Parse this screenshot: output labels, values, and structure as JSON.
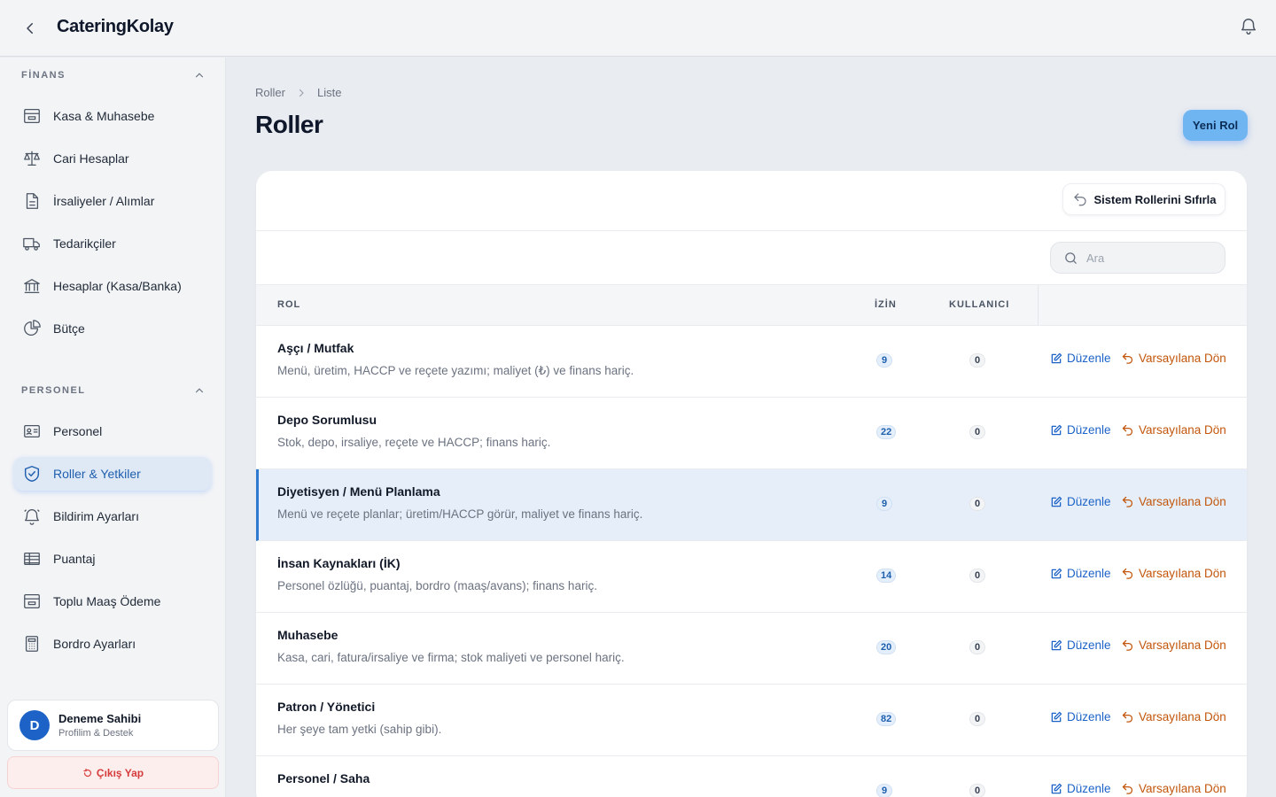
{
  "app": {
    "title": "CateringKolay"
  },
  "sidebar": {
    "sections": [
      {
        "label": "FİNANS",
        "items": [
          {
            "label": "Kasa & Muhasebe",
            "icon": "inbox-tray-icon"
          },
          {
            "label": "Cari Hesaplar",
            "icon": "scale-icon"
          },
          {
            "label": "İrsaliyeler / Alımlar",
            "icon": "document-icon"
          },
          {
            "label": "Tedarikçiler",
            "icon": "truck-icon"
          },
          {
            "label": "Hesaplar (Kasa/Banka)",
            "icon": "bank-icon"
          },
          {
            "label": "Bütçe",
            "icon": "pie-chart-icon"
          }
        ]
      },
      {
        "label": "PERSONEL",
        "items": [
          {
            "label": "Personel",
            "icon": "id-card-icon"
          },
          {
            "label": "Roller & Yetkiler",
            "icon": "shield-check-icon",
            "active": true
          },
          {
            "label": "Bildirim Ayarları",
            "icon": "bell-icon"
          },
          {
            "label": "Puantaj",
            "icon": "table-icon"
          },
          {
            "label": "Toplu Maaş Ödeme",
            "icon": "inbox-tray-icon"
          },
          {
            "label": "Bordro Ayarları",
            "icon": "calculator-icon"
          }
        ]
      }
    ],
    "user": {
      "initial": "D",
      "name": "Deneme Sahibi",
      "subtitle": "Profilim & Destek"
    },
    "logout_label": "Çıkış Yap"
  },
  "breadcrumb": {
    "parent": "Roller",
    "current": "Liste"
  },
  "page": {
    "title": "Roller",
    "new_button": "Yeni Rol"
  },
  "toolbar": {
    "reset_label": "Sistem Rollerini Sıfırla",
    "search_placeholder": "Ara"
  },
  "table": {
    "columns": {
      "role": "ROL",
      "permissions": "İZİN",
      "users": "KULLANICI"
    },
    "edit_label": "Düzenle",
    "reset_label": "Varsayılana Dön",
    "rows": [
      {
        "name": "Aşçı / Mutfak",
        "description": "Menü, üretim, HACCP ve reçete yazımı; maliyet (₺) ve finans hariç.",
        "permissions": "9",
        "users": "0"
      },
      {
        "name": "Depo Sorumlusu",
        "description": "Stok, depo, irsaliye, reçete ve HACCP; finans hariç.",
        "permissions": "22",
        "users": "0"
      },
      {
        "name": "Diyetisyen / Menü Planlama",
        "description": "Menü ve reçete planlar; üretim/HACCP görür, maliyet ve finans hariç.",
        "permissions": "9",
        "users": "0",
        "highlighted": true
      },
      {
        "name": "İnsan Kaynakları (İK)",
        "description": "Personel özlüğü, puantaj, bordro (maaş/avans); finans hariç.",
        "permissions": "14",
        "users": "0"
      },
      {
        "name": "Muhasebe",
        "description": "Kasa, cari, fatura/irsaliye ve firma; stok maliyeti ve personel hariç.",
        "permissions": "20",
        "users": "0"
      },
      {
        "name": "Patron / Yönetici",
        "description": "Her şeye tam yetki (sahip gibi).",
        "permissions": "82",
        "users": "0"
      },
      {
        "name": "Personel / Saha",
        "description": "",
        "permissions": "9",
        "users": "0"
      }
    ]
  },
  "colors": {
    "accent": "#1d63c7",
    "primary_button": "#6fb5f2",
    "reset_action": "#c2560c",
    "logout": "#d63b3b",
    "highlight_row": "#e6eff9"
  }
}
